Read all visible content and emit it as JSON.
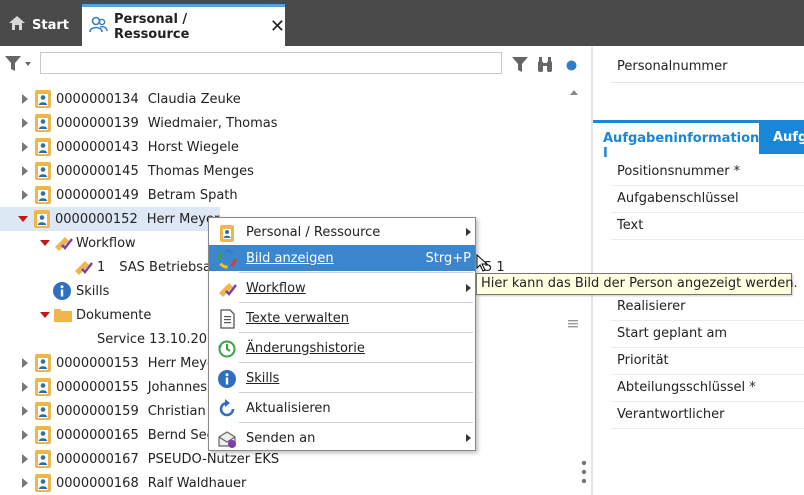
{
  "tabs": {
    "start_label": "Start",
    "active_label": "Personal / Ressource"
  },
  "tree": {
    "rows": [
      {
        "id": "0000000134",
        "name": "Claudia Zeuke"
      },
      {
        "id": "0000000139",
        "name": "Wiedmaier, Thomas"
      },
      {
        "id": "0000000143",
        "name": "Horst Wiegele"
      },
      {
        "id": "0000000145",
        "name": "Thomas Menges"
      },
      {
        "id": "0000000149",
        "name": "Betram Spath"
      },
      {
        "id": "0000000152",
        "name": "Herr Meyer"
      },
      {
        "id": "0000000153",
        "name": "Herr Meyer"
      },
      {
        "id": "0000000155",
        "name": "Johannes"
      },
      {
        "id": "0000000159",
        "name": "Christian C"
      },
      {
        "id": "0000000165",
        "name": "Bernd See"
      },
      {
        "id": "0000000167",
        "name": "PSEUDO-Nutzer EKS"
      },
      {
        "id": "0000000168",
        "name": "Ralf Waldhauer"
      }
    ],
    "workflow_label": "Workflow",
    "workflow_item_num": "1",
    "workflow_item_text": "SAS  Betriebsa",
    "workflow_item_extra": "5  1",
    "skills_label": "Skills",
    "dokumente_label": "Dokumente",
    "service_label": "Service  13.10.20"
  },
  "context_menu": {
    "items": [
      {
        "label": "Personal / Ressource",
        "submenu": true
      },
      {
        "label": "Bild anzeigen",
        "shortcut": "Strg+P"
      },
      {
        "label": "Workflow",
        "submenu": true
      },
      {
        "label": "Texte verwalten"
      },
      {
        "label": "Änderungshistorie"
      },
      {
        "label": "Skills"
      },
      {
        "label": "Aktualisieren"
      },
      {
        "label": "Senden an",
        "submenu": true
      }
    ]
  },
  "tooltip": "Hier kann das Bild der Person angezeigt werden.",
  "details": {
    "personalnummer": "Personalnummer",
    "tab_aufgabeninfo": "Aufgabeninformation I",
    "tab_next": "Aufg",
    "fields": [
      "Positionsnummer *",
      "Aufgabenschlüssel",
      "Text",
      "Realisierer",
      "Start geplant am",
      "Priorität",
      "Abteilungsschlüssel *",
      "Verantwortlicher"
    ]
  },
  "colors": {
    "topbar": "#4a4a4a",
    "accent": "#3b86cd",
    "tab_blue": "#1a86d8",
    "caret_red": "#c0161c",
    "folder": "#f0b64c"
  }
}
